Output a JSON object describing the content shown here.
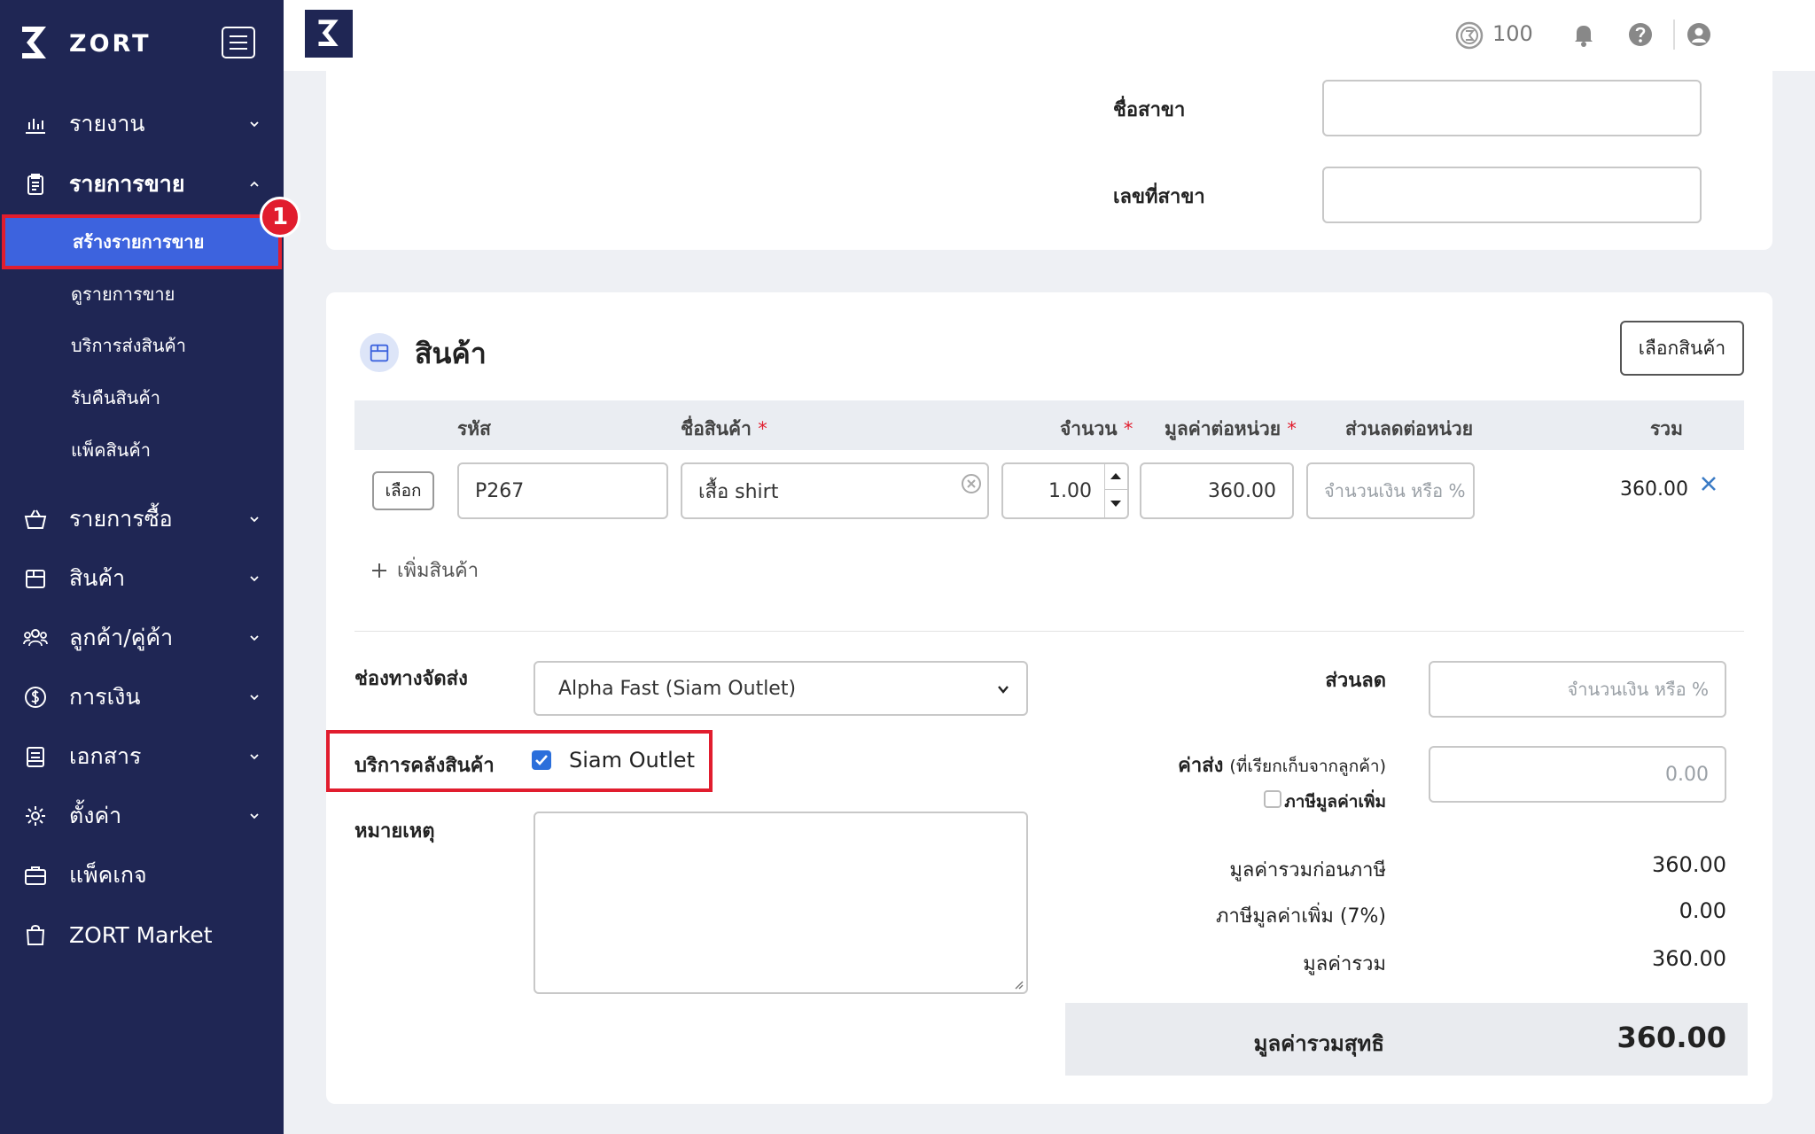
{
  "app": {
    "brand": "ZORT"
  },
  "sidebar": {
    "items": [
      {
        "label": "รายงาน",
        "icon": "bar-chart-icon"
      },
      {
        "label": "รายการขาย",
        "icon": "clipboard-icon"
      },
      {
        "label": "รายการซื้อ",
        "icon": "basket-icon"
      },
      {
        "label": "สินค้า",
        "icon": "box-icon"
      },
      {
        "label": "ลูกค้า/คู่ค้า",
        "icon": "users-icon"
      },
      {
        "label": "การเงิน",
        "icon": "dollar-icon"
      },
      {
        "label": "เอกสาร",
        "icon": "document-icon"
      },
      {
        "label": "ตั้งค่า",
        "icon": "gear-icon"
      },
      {
        "label": "แพ็คเกจ",
        "icon": "briefcase-icon"
      },
      {
        "label": "ZORT Market",
        "icon": "shopping-bag-icon"
      }
    ],
    "sales_sub": [
      {
        "label": "สร้างรายการขาย"
      },
      {
        "label": "ดูรายการขาย"
      },
      {
        "label": "บริการส่งสินค้า"
      },
      {
        "label": "รับคืนสินค้า"
      },
      {
        "label": "แพ็คสินค้า"
      }
    ],
    "step_badge": "1"
  },
  "topbar": {
    "coins": "100"
  },
  "branch": {
    "name_label": "ชื่อสาขา",
    "name_value": "",
    "number_label": "เลขที่สาขา",
    "number_value": ""
  },
  "products": {
    "title": "สินค้า",
    "choose_button": "เลือกสินค้า",
    "columns": {
      "code": "รหัส",
      "name": "ชื่อสินค้า",
      "qty": "จำนวน",
      "unit_price": "มูลค่าต่อหน่วย",
      "discount": "ส่วนลดต่อหน่วย",
      "total": "รวม",
      "required_mark": "*"
    },
    "rows": [
      {
        "select_label": "เลือก",
        "code": "P267",
        "name": "เสื้อ shirt",
        "qty": "1.00",
        "unit_price": "360.00",
        "discount_placeholder": "จำนวนเงิน หรือ %",
        "total": "360.00"
      }
    ],
    "add_label": "เพิ่มสินค้า"
  },
  "shipping": {
    "channel_label": "ช่องทางจัดส่ง",
    "channel_value": "Alpha Fast (Siam Outlet)",
    "warehouse_label": "บริการคลังสินค้า",
    "warehouse_option": "Siam Outlet",
    "warehouse_checked": true,
    "note_label": "หมายเหตุ"
  },
  "summary": {
    "discount_label": "ส่วนลด",
    "discount_placeholder": "จำนวนเงิน หรือ %",
    "shipping_label": "ค่าส่ง",
    "shipping_sub": "(ที่เรียกเก็บจากลูกค้า)",
    "shipping_value": "0.00",
    "vat_checkbox_label": "ภาษีมูลค่าเพิ่ม",
    "before_tax_label": "มูลค่ารวมก่อนภาษี",
    "before_tax_value": "360.00",
    "vat_label": "ภาษีมูลค่าเพิ่ม (7%)",
    "vat_value": "0.00",
    "total_label": "มูลค่ารวม",
    "total_value": "360.00",
    "net_label": "มูลค่ารวมสุทธิ",
    "net_value": "360.00"
  },
  "colors": {
    "sidebar": "#1f2654",
    "active": "#3d63de",
    "highlight": "#e11d2e",
    "accent": "#2b6fdb"
  }
}
